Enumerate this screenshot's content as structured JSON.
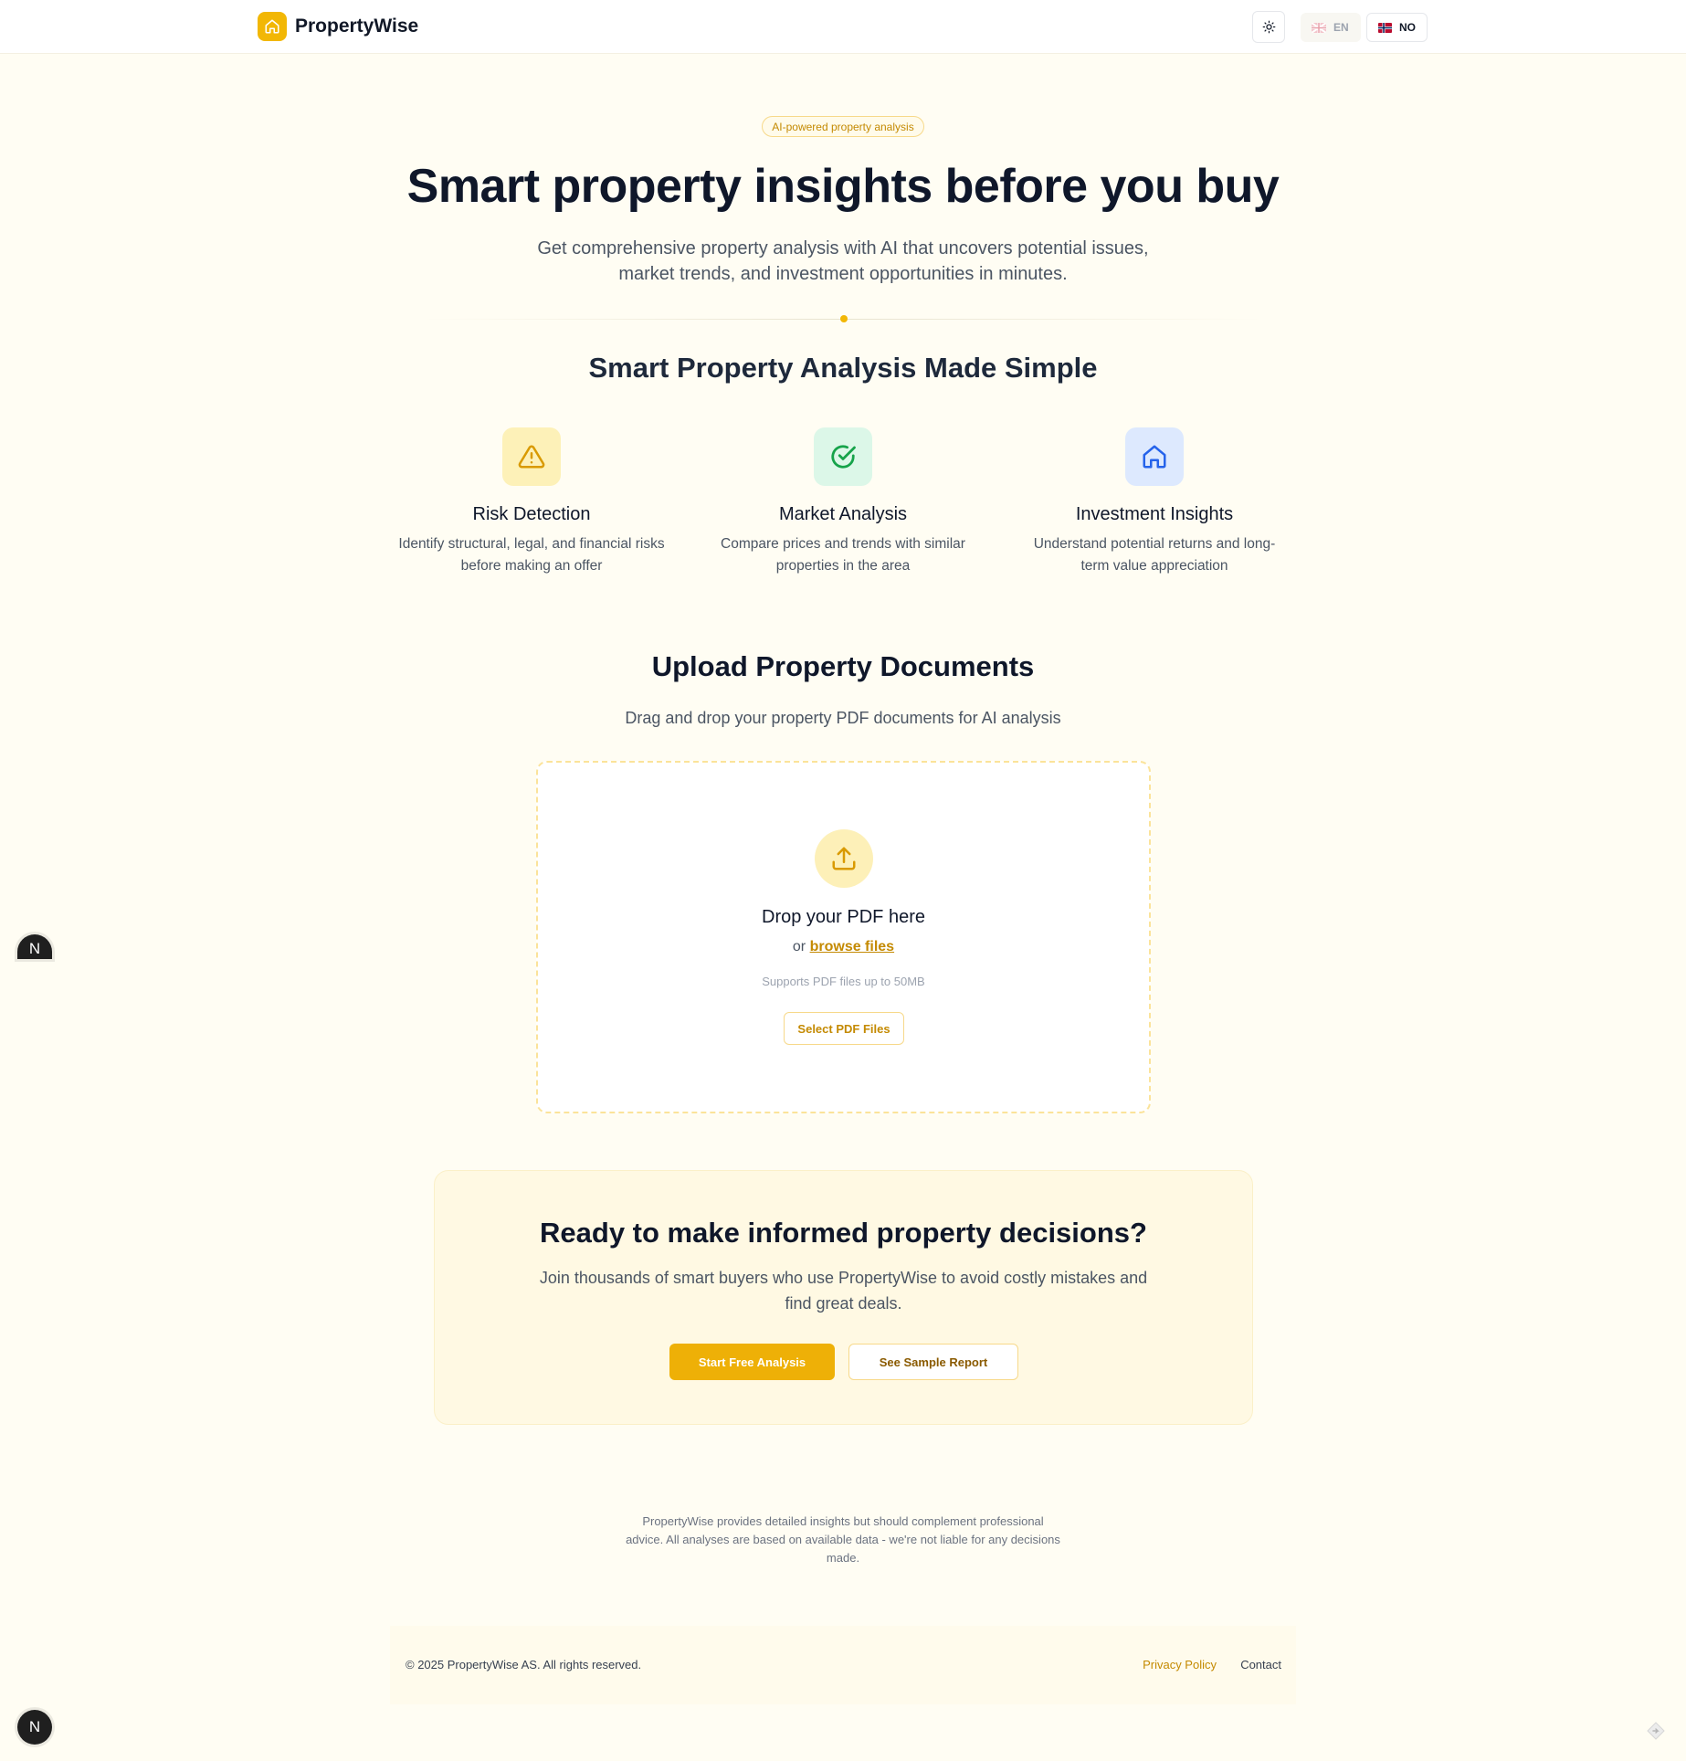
{
  "header": {
    "brand": "PropertyWise",
    "lang_en": "EN",
    "lang_no": "NO"
  },
  "hero": {
    "badge": "AI-powered property analysis",
    "title": "Smart property insights before you buy",
    "subtitle_line1": "Get comprehensive property analysis with AI that uncovers potential issues,",
    "subtitle_line2": "market trends, and investment opportunities in minutes."
  },
  "features": {
    "section_title": "Smart Property Analysis Made Simple",
    "items": [
      {
        "title": "Risk Detection",
        "desc_line1": "Identify structural, legal, and financial risks",
        "desc_line2": "before making an offer",
        "icon": "warning-triangle-icon",
        "color": "#d99a00"
      },
      {
        "title": "Market Analysis",
        "desc_line1": "Compare prices and trends with similar",
        "desc_line2": "properties in the area",
        "icon": "check-circle-icon",
        "color": "#16a34a"
      },
      {
        "title": "Investment Insights",
        "desc_line1": "Understand potential returns and long-",
        "desc_line2": "term value appreciation",
        "icon": "house-icon",
        "color": "#2563eb"
      }
    ]
  },
  "upload": {
    "title": "Upload Property Documents",
    "subtitle": "Drag and drop your property PDF documents for AI analysis",
    "drop_title": "Drop your PDF here",
    "or_text": "or",
    "browse_label": "browse files",
    "note": "Supports PDF files up to 50MB",
    "select_button": "Select PDF Files"
  },
  "cta": {
    "title": "Ready to make informed property decisions?",
    "subtitle_line1": "Join thousands of smart buyers who use PropertyWise to avoid costly mistakes and",
    "subtitle_line2": "find great deals.",
    "primary_button": "Start Free Analysis",
    "secondary_button": "See Sample Report"
  },
  "disclaimer": {
    "line1": "PropertyWise provides detailed insights but should complement professional",
    "line2": "advice. All analyses are based on available data - we're not liable for any decisions",
    "line3": "made."
  },
  "footer": {
    "copyright": "© 2025 PropertyWise AS. All rights reserved.",
    "privacy": "Privacy Policy",
    "contact": "Contact"
  },
  "dev_badge": {
    "letter": "N"
  },
  "colors": {
    "accent": "#f2b705",
    "accent_text": "#c48a02",
    "page_bg": "#fffdf3"
  }
}
